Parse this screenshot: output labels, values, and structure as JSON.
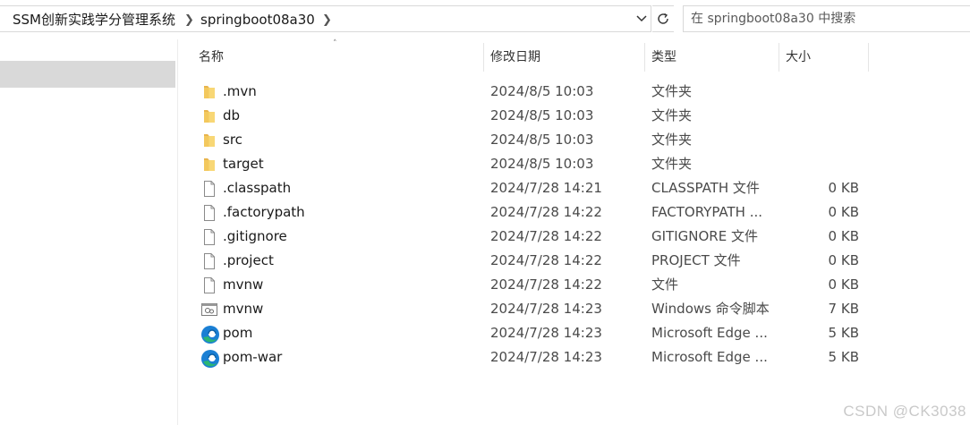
{
  "breadcrumb": {
    "items": [
      "SSM创新实践学分管理系统",
      "springboot08a30"
    ]
  },
  "search": {
    "placeholder": "在 springboot08a30 中搜索"
  },
  "columns": {
    "name": "名称",
    "date": "修改日期",
    "type": "类型",
    "size": "大小"
  },
  "files": [
    {
      "name": ".mvn",
      "date": "2024/8/5 10:03",
      "type": "文件夹",
      "size": "",
      "icon": "folder-icon"
    },
    {
      "name": "db",
      "date": "2024/8/5 10:03",
      "type": "文件夹",
      "size": "",
      "icon": "folder-icon"
    },
    {
      "name": "src",
      "date": "2024/8/5 10:03",
      "type": "文件夹",
      "size": "",
      "icon": "folder-icon"
    },
    {
      "name": "target",
      "date": "2024/8/5 10:03",
      "type": "文件夹",
      "size": "",
      "icon": "folder-icon"
    },
    {
      "name": ".classpath",
      "date": "2024/7/28 14:21",
      "type": "CLASSPATH 文件",
      "size": "0 KB",
      "icon": "file-icon"
    },
    {
      "name": ".factorypath",
      "date": "2024/7/28 14:22",
      "type": "FACTORYPATH ...",
      "size": "0 KB",
      "icon": "file-icon"
    },
    {
      "name": ".gitignore",
      "date": "2024/7/28 14:22",
      "type": "GITIGNORE 文件",
      "size": "0 KB",
      "icon": "file-icon"
    },
    {
      "name": ".project",
      "date": "2024/7/28 14:22",
      "type": "PROJECT 文件",
      "size": "0 KB",
      "icon": "file-icon"
    },
    {
      "name": "mvnw",
      "date": "2024/7/28 14:22",
      "type": "文件",
      "size": "0 KB",
      "icon": "file-icon"
    },
    {
      "name": "mvnw",
      "date": "2024/7/28 14:23",
      "type": "Windows 命令脚本",
      "size": "7 KB",
      "icon": "script-icon"
    },
    {
      "name": "pom",
      "date": "2024/7/28 14:23",
      "type": "Microsoft Edge ...",
      "size": "5 KB",
      "icon": "edge-icon"
    },
    {
      "name": "pom-war",
      "date": "2024/7/28 14:23",
      "type": "Microsoft Edge ...",
      "size": "5 KB",
      "icon": "edge-icon"
    }
  ],
  "watermark": "CSDN @CK3038",
  "colors": {
    "folder": "#f8d775",
    "selection": "#d9d9d9",
    "edge_blue": "#1a7fd4",
    "edge_green": "#2bb673"
  }
}
